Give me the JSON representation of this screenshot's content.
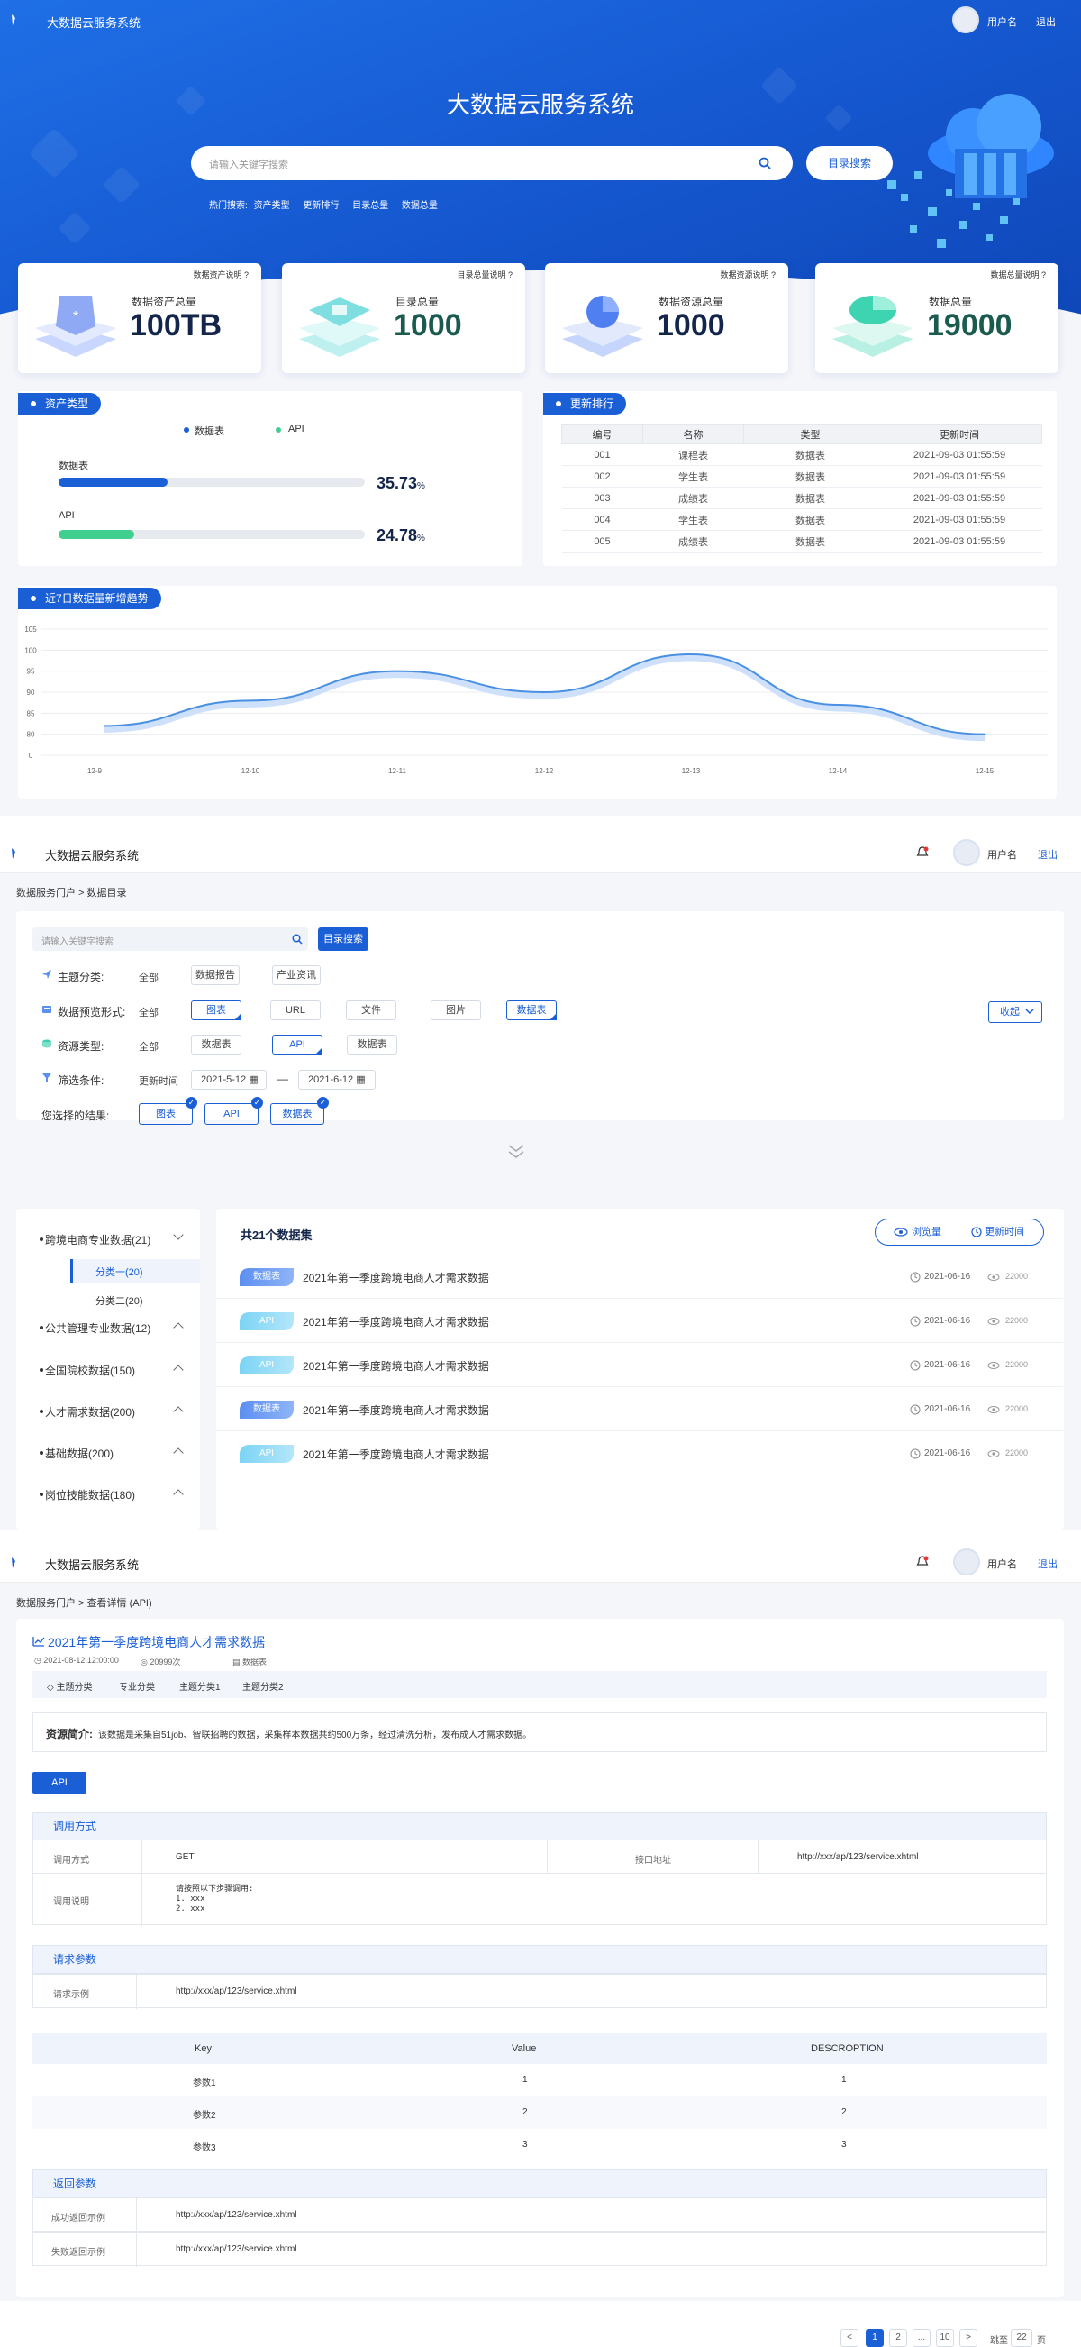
{
  "app": {
    "title": "大数据云服务系统",
    "username": "用户名",
    "logout": "退出"
  },
  "hero": {
    "title": "大数据云服务系统",
    "search_placeholder": "请输入关键字搜索",
    "catalog_search": "目录搜索",
    "hot_label": "热门搜索:",
    "hot_items": [
      "资产类型",
      "更新排行",
      "目录总量",
      "数据总量"
    ]
  },
  "stats": [
    {
      "note": "数据资产说明",
      "title": "数据资产总量",
      "value": "100TB"
    },
    {
      "note": "目录总量说明",
      "title": "目录总量",
      "value": "1000"
    },
    {
      "note": "数据资源说明",
      "title": "数据资源总量",
      "value": "1000"
    },
    {
      "note": "数据总量说明",
      "title": "数据总量",
      "value": "19000"
    }
  ],
  "asset_types": {
    "title": "资产类型",
    "legend": [
      "数据表",
      "API"
    ],
    "bars": [
      {
        "label": "数据表",
        "value": "35.73",
        "unit": "%",
        "fraction": 0.3573,
        "color": "#1a5fd6"
      },
      {
        "label": "API",
        "value": "24.78",
        "unit": "%",
        "fraction": 0.2478,
        "color": "#3fd08f"
      }
    ]
  },
  "update_rank": {
    "title": "更新排行",
    "headers": [
      "编号",
      "名称",
      "类型",
      "更新时间"
    ],
    "rows": [
      [
        "001",
        "课程表",
        "数据表",
        "2021-09-03   01:55:59"
      ],
      [
        "002",
        "学生表",
        "数据表",
        "2021-09-03   01:55:59"
      ],
      [
        "003",
        "成绩表",
        "数据表",
        "2021-09-03   01:55:59"
      ],
      [
        "004",
        "学生表",
        "数据表",
        "2021-09-03   01:55:59"
      ],
      [
        "005",
        "成绩表",
        "数据表",
        "2021-09-03   01:55:59"
      ]
    ]
  },
  "trend": {
    "title": "近7日数据量新增趋势"
  },
  "chart_data": {
    "type": "line",
    "title": "近7日数据量新增趋势",
    "x": [
      "12-9",
      "12-10",
      "12-11",
      "12-12",
      "12-13",
      "12-14",
      "12-15"
    ],
    "values": [
      82,
      88,
      95,
      90,
      99,
      87,
      80
    ],
    "yticks": [
      0,
      80,
      85,
      90,
      95,
      100,
      105
    ],
    "ylim": [
      0,
      105
    ],
    "grid": true,
    "color": "#4a90e2"
  },
  "catalog": {
    "breadcrumb": "数据服务门户 > 数据目录",
    "search_placeholder": "请输入关键字搜索",
    "search_button": "目录搜索",
    "filters": {
      "topic": {
        "label": "主题分类:",
        "all": "全部",
        "options": [
          "数据报告",
          "产业资讯"
        ]
      },
      "preview": {
        "label": "数据预览形式:",
        "all": "全部",
        "options": [
          "图表",
          "URL",
          "文件",
          "图片",
          "数据表"
        ]
      },
      "resource": {
        "label": "资源类型:",
        "all": "全部",
        "options": [
          "数据表",
          "API",
          "数据表"
        ]
      },
      "condition": {
        "label": "筛选条件:",
        "field": "更新时间",
        "from": "2021-5-12",
        "to": "2021-6-12",
        "dash": "—"
      },
      "result": {
        "label": "您选择的结果:",
        "tags": [
          "图表",
          "API",
          "数据表"
        ]
      }
    },
    "collapse": "收起",
    "tree": [
      {
        "label": "跨境电商专业数据(21)",
        "children": [
          "分类一(20)",
          "分类二(20)"
        ]
      },
      {
        "label": "公共管理专业数据(12)"
      },
      {
        "label": "全国院校数据(150)"
      },
      {
        "label": "人才需求数据(200)"
      },
      {
        "label": "基础数据(200)"
      },
      {
        "label": "岗位技能数据(180)"
      }
    ],
    "total": "共21个数据集",
    "sort": [
      "浏览量",
      "更新时间"
    ],
    "items": [
      {
        "type": "数据表",
        "title": "2021年第一季度跨境电商人才需求数据",
        "date": "2021-06-16",
        "views": "22000"
      },
      {
        "type": "API",
        "title": "2021年第一季度跨境电商人才需求数据",
        "date": "2021-06-16",
        "views": "22000"
      },
      {
        "type": "API",
        "title": "2021年第一季度跨境电商人才需求数据",
        "date": "2021-06-16",
        "views": "22000"
      },
      {
        "type": "数据表",
        "title": "2021年第一季度跨境电商人才需求数据",
        "date": "2021-06-16",
        "views": "22000"
      },
      {
        "type": "API",
        "title": "2021年第一季度跨境电商人才需求数据",
        "date": "2021-06-16",
        "views": "22000"
      }
    ],
    "pagination": {
      "prev": "<",
      "pages": [
        "1",
        "2",
        "...",
        "10"
      ],
      "next": ">",
      "goto": "跳至",
      "page_input": "22",
      "page_unit": "页"
    }
  },
  "detail": {
    "breadcrumb": "数据服务门户 > 查看详情 (API)",
    "title": "2021年第一季度跨境电商人才需求数据",
    "date": "2021-08-12  12:00:00",
    "views": "20999次",
    "type": "数据表",
    "topics": [
      "主题分类",
      "专业分类",
      "主题分类1",
      "主题分类2"
    ],
    "intro_label": "资源简介:",
    "intro": "该数据是采集自51job、智联招聘的数据，采集样本数据共约500万条，经过清洗分析，发布成人才需求数据。",
    "api_button": "API",
    "call": {
      "title": "调用方式",
      "method_label": "调用方式",
      "method": "GET",
      "addr_label": "接口地址",
      "addr": "http://xxx/ap/123/service.xhtml",
      "desc_label": "调用说明",
      "desc": [
        "请按照以下步骤调用:",
        "1. xxx",
        "2. xxx"
      ]
    },
    "request": {
      "title": "请求参数",
      "example_label": "请求示例",
      "example": "http://xxx/ap/123/service.xhtml"
    },
    "params": {
      "headers": [
        "Key",
        "Value",
        "DESCROPTION"
      ],
      "rows": [
        [
          "参数1",
          "1",
          "1"
        ],
        [
          "参数2",
          "2",
          "2"
        ],
        [
          "参数3",
          "3",
          "3"
        ]
      ]
    },
    "response": {
      "title": "返回参数",
      "success_label": "成功返回示例",
      "success": "http://xxx/ap/123/service.xhtml",
      "fail_label": "失败返回示例",
      "fail": "http://xxx/ap/123/service.xhtml"
    }
  }
}
